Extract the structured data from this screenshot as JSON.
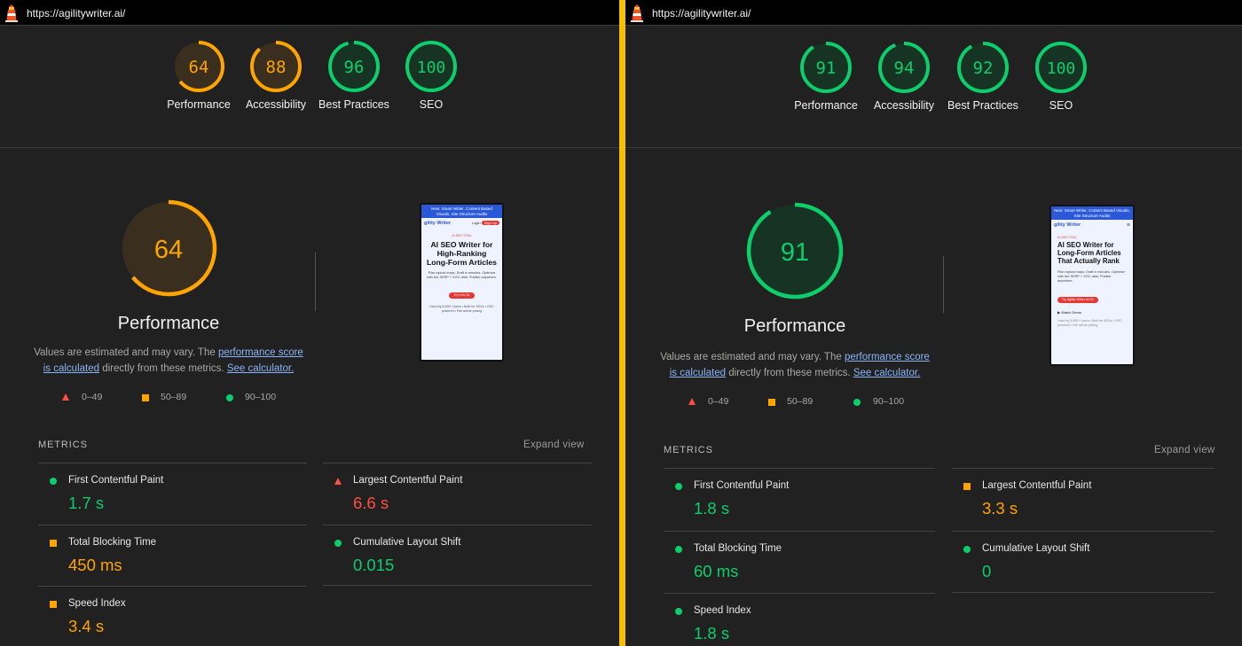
{
  "colors": {
    "pass": "#0cce6b",
    "average": "#ffa400",
    "fail": "#ff4e42",
    "separator": "#f5c000"
  },
  "left": {
    "url": "https://agilitywriter.ai/",
    "gauges": [
      {
        "label": "Performance",
        "score": "64",
        "status": "average"
      },
      {
        "label": "Accessibility",
        "score": "88",
        "status": "average"
      },
      {
        "label": "Best Practices",
        "score": "96",
        "status": "pass"
      },
      {
        "label": "SEO",
        "score": "100",
        "status": "pass"
      }
    ],
    "performance": {
      "score": "64",
      "status": "average",
      "title": "Performance",
      "desc_pre": "Values are estimated and may vary. The ",
      "desc_link1": "performance score is calculated",
      "desc_mid": " directly from these metrics. ",
      "desc_link2": "See calculator."
    },
    "legend": {
      "fail": "0–49",
      "average": "50–89",
      "pass": "90–100"
    },
    "thumbnail": {
      "banner": "New: Smart Writer, Content Based Visuals, Site Structure Audits",
      "brand": "gility Writer",
      "login": "Login",
      "signup": "Sign Up",
      "eyebrow": "AI SEO TOOL",
      "headline": "AI SEO Writer for High-Ranking Long-Form Articles",
      "sub": "Plan topical maps. Draft in minutes. Optimize with live SERP + GSC data. Publish anywhere.",
      "cta": "Try it for $1",
      "fine": "Used by 5,000+ Users • Built for SEOs • GSC powered • Fair article pricing"
    },
    "metrics_label": "METRICS",
    "expand_label": "Expand view",
    "metrics": [
      {
        "name": "First Contentful Paint",
        "value": "1.7 s",
        "status": "pass"
      },
      {
        "name": "Largest Contentful Paint",
        "value": "6.6 s",
        "status": "fail"
      },
      {
        "name": "Total Blocking Time",
        "value": "450 ms",
        "status": "average"
      },
      {
        "name": "Cumulative Layout Shift",
        "value": "0.015",
        "status": "pass"
      },
      {
        "name": "Speed Index",
        "value": "3.4 s",
        "status": "average"
      }
    ]
  },
  "right": {
    "url": "https://agilitywriter.ai/",
    "gauges": [
      {
        "label": "Performance",
        "score": "91",
        "status": "pass"
      },
      {
        "label": "Accessibility",
        "score": "94",
        "status": "pass"
      },
      {
        "label": "Best Practices",
        "score": "92",
        "status": "pass"
      },
      {
        "label": "SEO",
        "score": "100",
        "status": "pass"
      }
    ],
    "performance": {
      "score": "91",
      "status": "pass",
      "title": "Performance",
      "desc_pre": "Values are estimated and may vary. The ",
      "desc_link1": "performance score is calculated",
      "desc_mid": " directly from these metrics. ",
      "desc_link2": "See calculator."
    },
    "legend": {
      "fail": "0–49",
      "average": "50–89",
      "pass": "90–100"
    },
    "thumbnail": {
      "banner": "New: Smart Writer, Content Based Visuals, Site Structure Audits",
      "brand": "gility Writer",
      "menu": "≡",
      "eyebrow": "AI SEO TOOL",
      "headline": "AI SEO Writer for Long-Form Articles That Actually Rank",
      "sub": "Plan topical maps. Draft in minutes. Optimize with live SERP + GSC data. Publish anywhere.",
      "cta": "Try Agility Writer for $1",
      "watch": "Watch Demo",
      "fine": "Used by 5,000+ Users • Built for SEOs • GSC powered • Fair article pricing"
    },
    "metrics_label": "METRICS",
    "expand_label": "Expand view",
    "metrics": [
      {
        "name": "First Contentful Paint",
        "value": "1.8 s",
        "status": "pass"
      },
      {
        "name": "Largest Contentful Paint",
        "value": "3.3 s",
        "status": "average"
      },
      {
        "name": "Total Blocking Time",
        "value": "60 ms",
        "status": "pass"
      },
      {
        "name": "Cumulative Layout Shift",
        "value": "0",
        "status": "pass"
      },
      {
        "name": "Speed Index",
        "value": "1.8 s",
        "status": "pass"
      }
    ]
  }
}
